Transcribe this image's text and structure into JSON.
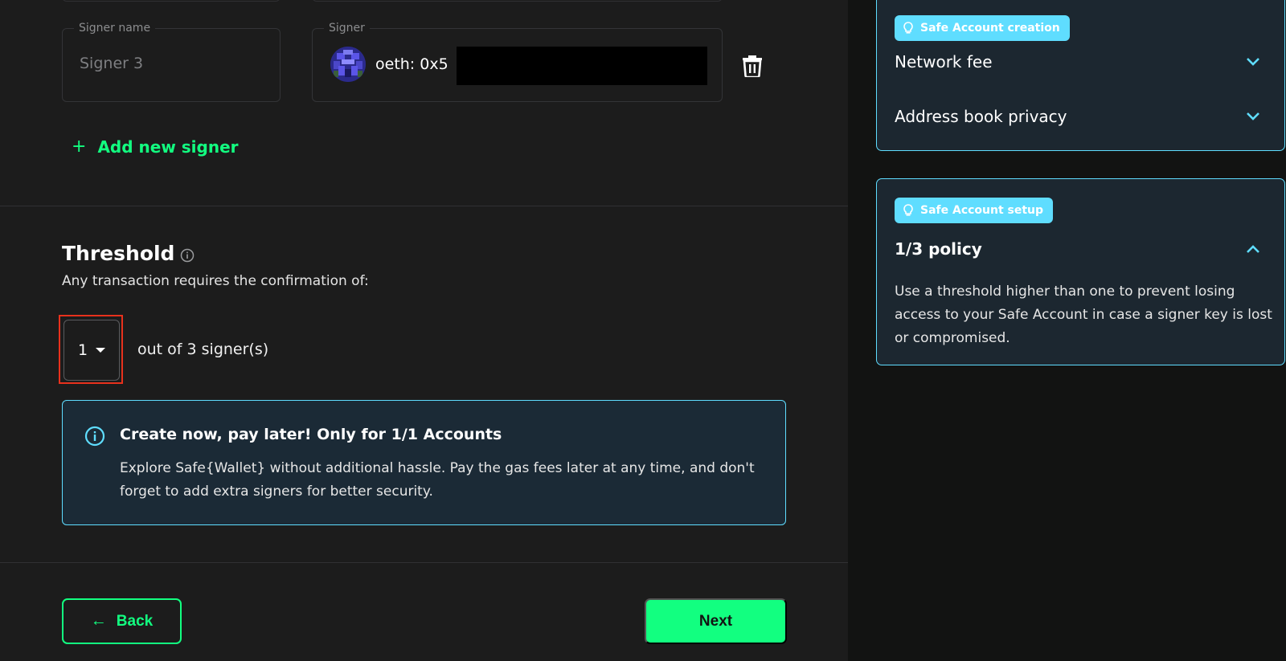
{
  "signer_row": {
    "name_label": "Signer name",
    "name_placeholder": "Signer 3",
    "signer_label": "Signer",
    "signer_address_prefix": "oeth: 0x5"
  },
  "add_signer": {
    "icon": "plus-icon",
    "label": "Add new signer"
  },
  "threshold": {
    "title": "Threshold",
    "subtitle": "Any transaction requires the confirmation of:",
    "selected_value": "1",
    "out_of_text": "out of 3 signer(s)"
  },
  "alert": {
    "title": "Create now, pay later! Only for 1/1 Accounts",
    "body": "Explore Safe{Wallet} without additional hassle. Pay the gas fees later at any time, and don't forget to add extra signers for better security."
  },
  "footer": {
    "back_label": "Back",
    "next_label": "Next"
  },
  "sidebar": {
    "creation_card": {
      "chip": "Safe Account creation",
      "items": [
        {
          "label": "Network fee",
          "state": "collapsed"
        },
        {
          "label": "Address book privacy",
          "state": "collapsed"
        }
      ]
    },
    "setup_card": {
      "chip": "Safe Account setup",
      "title": "1/3 policy",
      "state": "expanded",
      "text": "Use a threshold higher than one to prevent losing access to your Safe Account in case a signer key is lost or compromised."
    }
  },
  "colors": {
    "accent_green": "#12ff80",
    "info_blue": "#5fddff",
    "highlight_red": "#e8311c",
    "panel_bg": "#1c1c1c",
    "page_bg": "#121312"
  }
}
